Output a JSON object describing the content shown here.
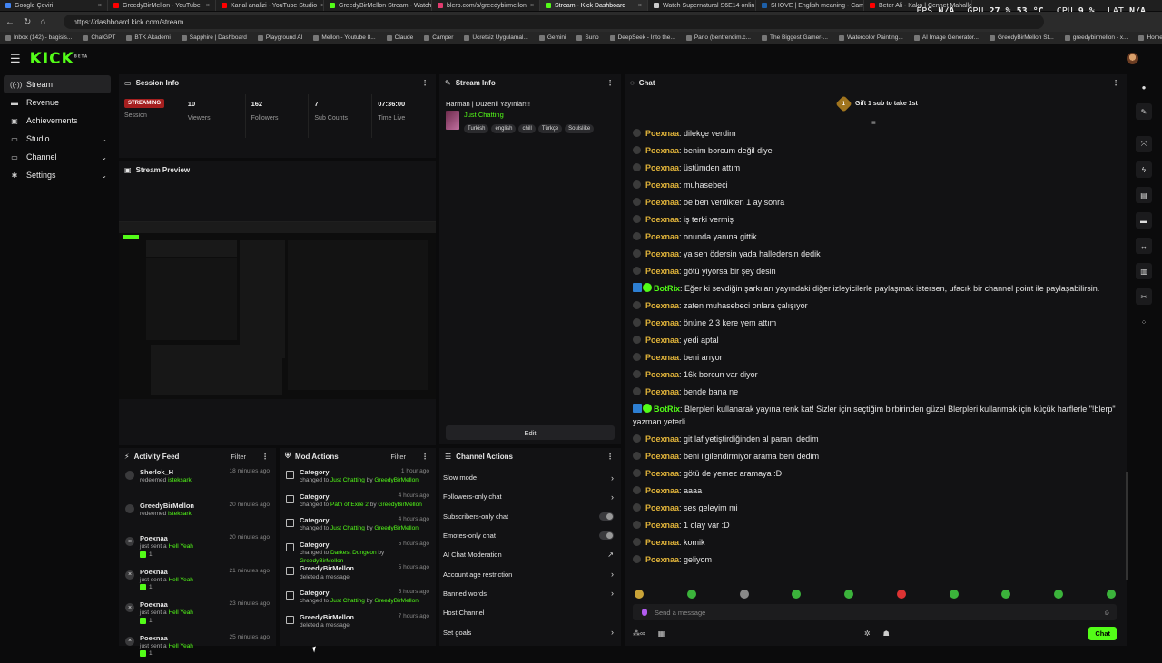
{
  "browser": {
    "tabs": [
      {
        "title": "Google Çeviri",
        "color": "#4285f4",
        "active": false
      },
      {
        "title": "GreedyBirMellon - YouTube",
        "color": "#ff0000",
        "active": false
      },
      {
        "title": "Kanal analizi - YouTube Studio",
        "color": "#ff0000",
        "active": false
      },
      {
        "title": "GreedyBirMellon Stream - Watch",
        "color": "#53fc18",
        "active": false
      },
      {
        "title": "blerp.com/s/greedybirmellon",
        "color": "#e23b6f",
        "active": false
      },
      {
        "title": "Stream - Kick Dashboard",
        "color": "#53fc18",
        "active": true
      },
      {
        "title": "Watch Supernatural S6E14 onlin",
        "color": "#cccccc",
        "active": false
      },
      {
        "title": "SHOVE | English meaning - Camb",
        "color": "#1d5fa8",
        "active": false
      },
      {
        "title": "Beter Ali - Kako | Cennet Mahalle",
        "color": "#ff0000",
        "active": false
      }
    ],
    "url": "https://dashboard.kick.com/stream",
    "bookmarks": [
      "Inbox (142) - bagisis...",
      "ChatGPT",
      "BTK Akademi",
      "Sapphire | Dashboard",
      "Playground AI",
      "Mellon - Youtube 8...",
      "Claude",
      "Camper",
      "Ücretsiz Uygulamal...",
      "Gemini",
      "Suno",
      "DeepSeek - Into the...",
      "Pano (bentrendim.c...",
      "The Biggest Gamer-...",
      "Watercolor Painting...",
      "AI Image Generator...",
      "GreedyBirMellon St...",
      "greedybirmellon - x...",
      "Home / X"
    ],
    "overlay": {
      "fps_label": "FPS",
      "fps_val": "N/A",
      "gpu_label": "GPU",
      "gpu_val": "27 %  53 °C",
      "cpu_label": "CPU",
      "cpu_val": "9 %",
      "lat_label": "LAT",
      "lat_val": "N/A"
    }
  },
  "app": {
    "logo": "KICK",
    "logo_sup": "BETA",
    "sidebar": [
      {
        "label": "Stream",
        "icon": "radio-icon",
        "glyph": "((·))",
        "active": true,
        "chevron": false
      },
      {
        "label": "Revenue",
        "icon": "wallet-icon",
        "glyph": "▬",
        "active": false,
        "chevron": false
      },
      {
        "label": "Achievements",
        "icon": "trophy-icon",
        "glyph": "▣",
        "active": false,
        "chevron": false
      },
      {
        "label": "Studio",
        "icon": "studio-icon",
        "glyph": "▭",
        "active": false,
        "chevron": true
      },
      {
        "label": "Channel",
        "icon": "channel-icon",
        "glyph": "▭",
        "active": false,
        "chevron": true
      },
      {
        "label": "Settings",
        "icon": "gear-icon",
        "glyph": "✱",
        "active": false,
        "chevron": true
      }
    ]
  },
  "session": {
    "title": "Session Info",
    "status": "STREAMING",
    "status_label": "Session",
    "viewers": "10",
    "viewers_label": "Viewers",
    "followers": "162",
    "followers_label": "Followers",
    "subs": "7",
    "subs_label": "Sub Counts",
    "live_time": "07:36:00",
    "live_label": "Time Live"
  },
  "preview": {
    "title": "Stream Preview"
  },
  "stream_info": {
    "title": "Stream Info",
    "stream_title": "Harman | Düzenli Yayınlar!!!",
    "category": "Just Chatting",
    "tags": [
      "Turkish",
      "english",
      "chill",
      "Türkçe",
      "Soulslike"
    ],
    "edit": "Edit"
  },
  "activity": {
    "title": "Activity Feed",
    "filter": "Filter",
    "items": [
      {
        "name": "Sherlok_H",
        "action": "redeemed",
        "reward": "isteksarkı",
        "time": "18 minutes ago",
        "count": ""
      },
      {
        "name": "GreedyBirMellon",
        "action": "redeemed",
        "reward": "isteksarkı",
        "time": "20 minutes ago",
        "count": ""
      },
      {
        "name": "Poexnaa",
        "action": "just sent a",
        "reward": "Hell Yeah",
        "time": "20 minutes ago",
        "count": "1"
      },
      {
        "name": "Poexnaa",
        "action": "just sent a",
        "reward": "Hell Yeah",
        "time": "21 minutes ago",
        "count": "1"
      },
      {
        "name": "Poexnaa",
        "action": "just sent a",
        "reward": "Hell Yeah",
        "time": "23 minutes ago",
        "count": "1"
      },
      {
        "name": "Poexnaa",
        "action": "just sent a",
        "reward": "Hell Yeah",
        "time": "25 minutes ago",
        "count": "1"
      }
    ]
  },
  "mod": {
    "title": "Mod Actions",
    "filter": "Filter",
    "items": [
      {
        "name": "Category",
        "pre": "changed to",
        "target": "Just Chatting",
        "by": "by",
        "user": "GreedyBirMellon",
        "time": "1 hour ago"
      },
      {
        "name": "Category",
        "pre": "changed to",
        "target": "Path of Exile 2",
        "by": "by",
        "user": "GreedyBirMellon",
        "time": "4 hours ago"
      },
      {
        "name": "Category",
        "pre": "changed to",
        "target": "Just Chatting",
        "by": "by",
        "user": "GreedyBirMellon",
        "time": "4 hours ago"
      },
      {
        "name": "Category",
        "pre": "changed to",
        "target": "Darkest Dungeon",
        "by": "by",
        "user": "GreedyBirMellon",
        "time": "5 hours ago"
      },
      {
        "name": "GreedyBirMellon",
        "pre": "deleted a message",
        "target": "",
        "by": "",
        "user": "",
        "time": "5 hours ago"
      },
      {
        "name": "Category",
        "pre": "changed to",
        "target": "Just Chatting",
        "by": "by",
        "user": "GreedyBirMellon",
        "time": "5 hours ago"
      },
      {
        "name": "GreedyBirMellon",
        "pre": "deleted a message",
        "target": "",
        "by": "",
        "user": "",
        "time": "7 hours ago"
      }
    ]
  },
  "channel_actions": {
    "title": "Channel Actions",
    "items": [
      {
        "label": "Slow mode",
        "kind": "chevron"
      },
      {
        "label": "Followers-only chat",
        "kind": "chevron"
      },
      {
        "label": "Subscribers-only chat",
        "kind": "toggle"
      },
      {
        "label": "Emotes-only chat",
        "kind": "toggle"
      },
      {
        "label": "AI Chat Moderation",
        "kind": "external"
      },
      {
        "label": "Account age restriction",
        "kind": "chevron"
      },
      {
        "label": "Banned words",
        "kind": "chevron"
      },
      {
        "label": "Host Channel",
        "kind": "none"
      },
      {
        "label": "Set goals",
        "kind": "chevron"
      }
    ]
  },
  "chat": {
    "title": "Chat",
    "pinned": "Gift 1 sub to take 1st",
    "pinned_rank": "1",
    "messages": [
      {
        "user": "Poexnaa",
        "text": "dilekçe verdim",
        "bot": false
      },
      {
        "user": "Poexnaa",
        "text": "benim borcum değil diye",
        "bot": false
      },
      {
        "user": "Poexnaa",
        "text": "üstümden attım",
        "bot": false
      },
      {
        "user": "Poexnaa",
        "text": "muhasebeci",
        "bot": false
      },
      {
        "user": "Poexnaa",
        "text": "oe ben verdikten 1 ay sonra",
        "bot": false
      },
      {
        "user": "Poexnaa",
        "text": "iş terki vermiş",
        "bot": false
      },
      {
        "user": "Poexnaa",
        "text": "onunda yanına gittik",
        "bot": false
      },
      {
        "user": "Poexnaa",
        "text": "ya sen ödersin yada halledersin dedik",
        "bot": false
      },
      {
        "user": "Poexnaa",
        "text": "götü yiyorsa bir şey desin",
        "bot": false
      },
      {
        "user": "BotRix",
        "text": "Eğer ki sevdiğin şarkıları yayındaki diğer izleyicilerle paylaşmak istersen, ufacık bir channel point ile paylaşabilirsin.",
        "bot": true
      },
      {
        "user": "Poexnaa",
        "text": "zaten muhasebeci onlara çalışıyor",
        "bot": false
      },
      {
        "user": "Poexnaa",
        "text": "önüne 2 3 kere yem attım",
        "bot": false
      },
      {
        "user": "Poexnaa",
        "text": "yedi aptal",
        "bot": false
      },
      {
        "user": "Poexnaa",
        "text": "beni arıyor",
        "bot": false
      },
      {
        "user": "Poexnaa",
        "text": "16k borcun var diyor",
        "bot": false
      },
      {
        "user": "Poexnaa",
        "text": "bende bana ne",
        "bot": false
      },
      {
        "user": "BotRix",
        "text": "Blerpleri kullanarak yayına renk kat! Sizler için seçtiğim birbirinden güzel Blerpleri kullanmak için küçük harflerle \"!blerp\" yazman yeterli.",
        "bot": true
      },
      {
        "user": "Poexnaa",
        "text": "git laf yetiştirdiğinden al paranı dedim",
        "bot": false
      },
      {
        "user": "Poexnaa",
        "text": "beni ilgilendirmiyor arama beni dedim",
        "bot": false
      },
      {
        "user": "Poexnaa",
        "text": "götü de yemez aramaya :D",
        "bot": false
      },
      {
        "user": "Poexnaa",
        "text": "aaaa",
        "bot": false
      },
      {
        "user": "Poexnaa",
        "text": "ses geleyim mi",
        "bot": false
      },
      {
        "user": "Poexnaa",
        "text": "1 olay var :D",
        "bot": false
      },
      {
        "user": "Poexnaa",
        "text": "komik",
        "bot": false
      },
      {
        "user": "Poexnaa",
        "text": "geliyom",
        "bot": false
      }
    ],
    "input_placeholder": "Send a message",
    "send": "Chat",
    "emote_count_label": ""
  }
}
